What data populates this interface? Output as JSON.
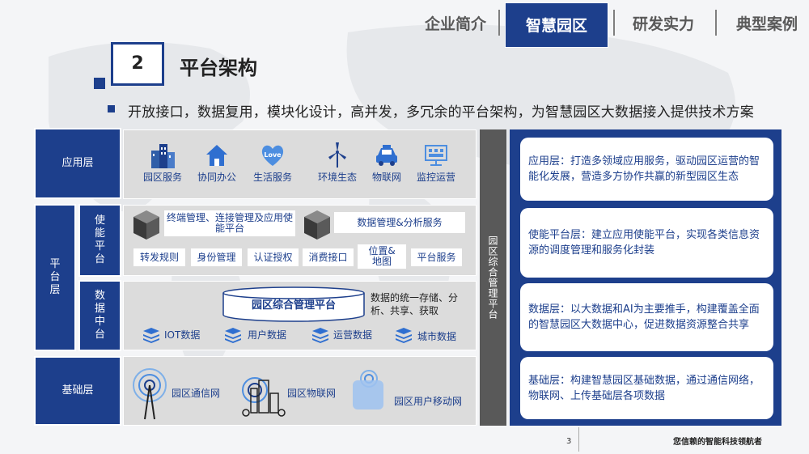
{
  "nav": {
    "items": [
      "企业简介",
      "智慧园区",
      "研发实力",
      "典型案例"
    ],
    "active_index": 1
  },
  "section": {
    "number": "2",
    "title": "平台架构",
    "subtitle": "开放接口，数据复用，模块化设计，高并发，多冗余的平台架构，为智慧园区大数据接入提供技术方案"
  },
  "layers": {
    "app": "应用层",
    "platform": "平台层",
    "enable": "使能平台",
    "data": "数据中台",
    "base": "基础层"
  },
  "app_icons": [
    {
      "label": "园区服务",
      "icon": "building-icon"
    },
    {
      "label": "协同办公",
      "icon": "house-icon"
    },
    {
      "label": "生活服务",
      "icon": "love-heart-icon"
    },
    {
      "label": "环境生态",
      "icon": "wind-turbine-icon"
    },
    {
      "label": "物联网",
      "icon": "taxi-icon"
    },
    {
      "label": "监控运营",
      "icon": "monitor-screen-icon"
    }
  ],
  "enable": {
    "block1": "终端管理、连接管理及应用使能平台",
    "block2": "数据管理&分析服务",
    "chips": [
      "转发规则",
      "身份管理",
      "认证授权",
      "消费接口",
      "位置&地图",
      "平台服务"
    ]
  },
  "data_platform": {
    "cylinder": "园区综合管理平台",
    "desc": "数据的统一存储、分析、共享、获取",
    "items": [
      "IOT数据",
      "用户数据",
      "运营数据",
      "城市数据"
    ]
  },
  "base": {
    "items": [
      "园区通信网",
      "园区物联网",
      "园区用户移动网"
    ]
  },
  "side_bar": "园区综合管理平台",
  "cards": [
    "应用层：打造多领域应用服务，驱动园区运营的智能化发展，营造多方协作共赢的新型园区生态",
    "使能平台层：建立应用使能平台，实现各类信息资源的调度管理和服务化封装",
    "数据层：以大数据和AI为主要推手，构建覆盖全面的智慧园区大数据中心，促进数据资源整合共享",
    "基础层：构建智慧园区基础数据，通过通信网络，物联网、上传基础层各项数据"
  ],
  "footer": {
    "page": "3",
    "slogan": "您信赖的智能科技领航者"
  },
  "colors": {
    "primary": "#1d3f8c",
    "panel": "#dcdcdc",
    "bar": "#595959"
  }
}
